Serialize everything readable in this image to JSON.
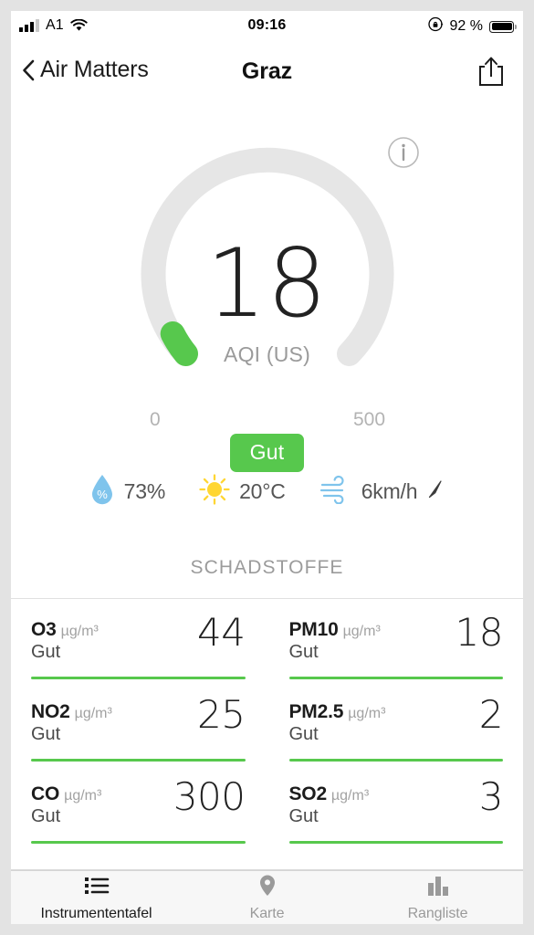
{
  "statusbar": {
    "carrier": "A1",
    "time": "09:16",
    "battery_percent": "92 %",
    "signal_icon": "cellular-signal-icon",
    "wifi_icon": "wifi-icon",
    "rotation_lock_icon": "rotation-lock-icon",
    "battery_icon": "battery-icon"
  },
  "navbar": {
    "back_label": "Air Matters",
    "title": "Graz",
    "back_icon": "chevron-left-icon",
    "share_icon": "share-icon"
  },
  "gauge": {
    "value": "18",
    "unit_label": "AQI (US)",
    "scale_min": "0",
    "scale_max": "500",
    "status_label": "Gut",
    "info_icon": "info-icon",
    "track_color": "#e6e6e6",
    "fill_color": "#57c84d",
    "value_numeric": 18,
    "range_min": 0,
    "range_max": 500
  },
  "weather": {
    "items": [
      {
        "icon": "humidity-drop-icon",
        "value": "73%",
        "color": "#7fc4ec"
      },
      {
        "icon": "sun-icon",
        "value": "20°C",
        "color": "#ffd633"
      },
      {
        "icon": "wind-icon",
        "value": "6km/h",
        "color": "#7fc4ec"
      }
    ],
    "wind_direction_icon": "navigation-arrow-icon"
  },
  "pollutants": {
    "section_title": "SCHADSTOFFE",
    "items": [
      {
        "name": "O3",
        "unit": "µg/m³",
        "status": "Gut",
        "value": "44",
        "bar_color": "#57c84d"
      },
      {
        "name": "PM10",
        "unit": "µg/m³",
        "status": "Gut",
        "value": "18",
        "bar_color": "#57c84d"
      },
      {
        "name": "NO2",
        "unit": "µg/m³",
        "status": "Gut",
        "value": "25",
        "bar_color": "#57c84d"
      },
      {
        "name": "PM2.5",
        "unit": "µg/m³",
        "status": "Gut",
        "value": "2",
        "bar_color": "#57c84d"
      },
      {
        "name": "CO",
        "unit": "µg/m³",
        "status": "Gut",
        "value": "300",
        "bar_color": "#57c84d"
      },
      {
        "name": "SO2",
        "unit": "µg/m³",
        "status": "Gut",
        "value": "3",
        "bar_color": "#57c84d"
      }
    ]
  },
  "tabbar": {
    "items": [
      {
        "label": "Instrumententafel",
        "icon": "list-icon",
        "active": true
      },
      {
        "label": "Karte",
        "icon": "map-pin-icon",
        "active": false
      },
      {
        "label": "Rangliste",
        "icon": "bar-chart-icon",
        "active": false
      }
    ]
  }
}
